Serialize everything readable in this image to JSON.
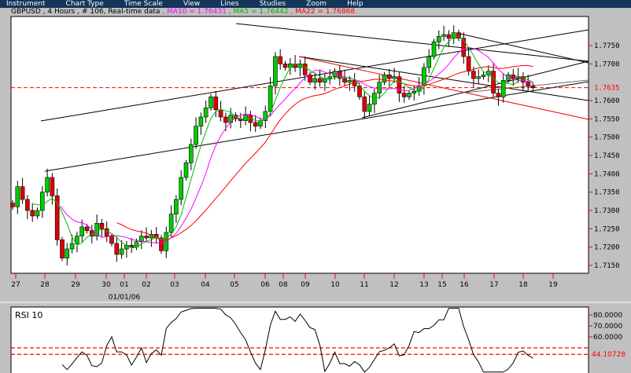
{
  "menu": [
    "Instrument",
    "Chart Type",
    "Time Scale",
    "View",
    "Lines",
    "Studies",
    "Zoom",
    "Help"
  ],
  "info": {
    "symbol": "GBPUSD",
    "timeframe": "4 Hours",
    "bars": "# 106",
    "mode": "Real-time data",
    "ma10": "MA10 = 1.76431",
    "ma5": "MA5 = 1.76442",
    "ma22": "MA22 = 1.76868"
  },
  "colors": {
    "ma10": "#ff00ff",
    "ma5": "#00c000",
    "ma22": "#ff0000",
    "up": "#00cc00",
    "down": "#e00000",
    "menubar": "#13355a"
  },
  "chart_data": [
    {
      "type": "candlestick",
      "symbol": "GBPUSD",
      "yticks": [
        "1.7750",
        "1.7700",
        "1.7600",
        "1.7550",
        "1.7500",
        "1.7450",
        "1.7400",
        "1.7350",
        "1.7300",
        "1.7250",
        "1.7200",
        "1.7150"
      ],
      "ylim": [
        1.713,
        1.78
      ],
      "current_price_label": "1.7635",
      "current_price": 1.7635,
      "xticks": [
        "27",
        "28",
        "29",
        "30",
        "01",
        "02",
        "03",
        "04",
        "05",
        "06",
        "08",
        "09",
        "10",
        "11",
        "12",
        "13",
        "15",
        "16",
        "17",
        "18",
        "19"
      ],
      "date_label": "01/01/06",
      "close": [
        1.731,
        1.7365,
        1.733,
        1.73,
        1.7285,
        1.73,
        1.735,
        1.739,
        1.734,
        1.722,
        1.717,
        1.7195,
        1.721,
        1.723,
        1.7255,
        1.7245,
        1.723,
        1.7265,
        1.725,
        1.723,
        1.721,
        1.718,
        1.7195,
        1.7205,
        1.72,
        1.7215,
        1.723,
        1.7225,
        1.7235,
        1.7225,
        1.719,
        1.724,
        1.729,
        1.733,
        1.739,
        1.743,
        1.748,
        1.753,
        1.7555,
        1.758,
        1.761,
        1.7575,
        1.7555,
        1.754,
        1.756,
        1.755,
        1.7545,
        1.756,
        1.754,
        1.753,
        1.7545,
        1.757,
        1.764,
        1.772,
        1.77,
        1.769,
        1.77,
        1.769,
        1.77,
        1.767,
        1.765,
        1.766,
        1.765,
        1.766,
        1.7665,
        1.768,
        1.766,
        1.765,
        1.7655,
        1.764,
        1.761,
        1.757,
        1.759,
        1.762,
        1.765,
        1.767,
        1.766,
        1.7665,
        1.762,
        1.761,
        1.762,
        1.7625,
        1.764,
        1.769,
        1.772,
        1.776,
        1.7775,
        1.778,
        1.777,
        1.7785,
        1.777,
        1.772,
        1.768,
        1.766,
        1.7665,
        1.767,
        1.768,
        1.762,
        1.761,
        1.7655,
        1.767,
        1.766,
        1.7665,
        1.765,
        1.764,
        1.7635
      ],
      "moving_averages": [
        {
          "name": "MA10",
          "period": 10
        },
        {
          "name": "MA5",
          "period": 5
        },
        {
          "name": "MA22",
          "period": 22
        }
      ]
    },
    {
      "type": "line",
      "title": "RSI 10",
      "period": 10,
      "yticks": [
        "80.0000",
        "70.0000",
        "60.0000"
      ],
      "current_label": "44.10728",
      "current_value": 44.10728,
      "levels": [
        50,
        44.1
      ],
      "ylim": [
        27,
        88
      ]
    }
  ]
}
